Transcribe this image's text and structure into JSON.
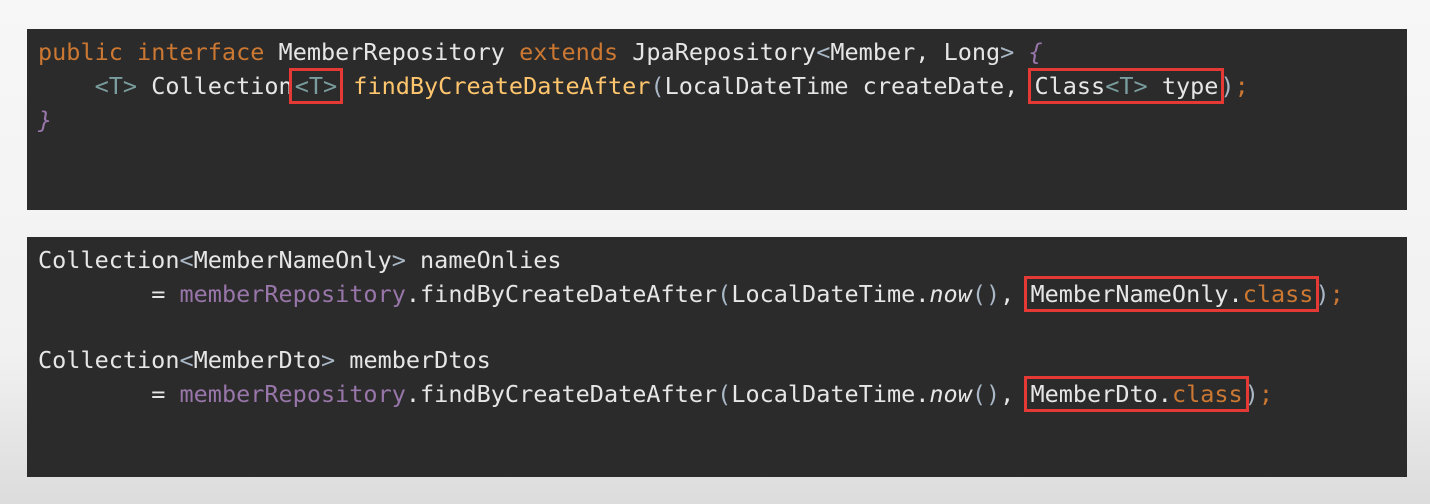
{
  "snippet1": {
    "line1": {
      "public": "public",
      "interface": "interface",
      "name": "MemberRepository",
      "extends": "extends",
      "super": "JpaRepository",
      "lt": "<",
      "arg1": "Member",
      "comma": ", ",
      "arg2": "Long",
      "gt": ">",
      "brace": "{"
    },
    "line2": {
      "indent": "    ",
      "tparam_decl": "<T>",
      "collection": "Collection",
      "return_tparam": "<T>",
      "method": "findByCreateDateAfter",
      "open_paren": "(",
      "param1_type": "LocalDateTime",
      "param1_name": "createDate",
      "comma": ", ",
      "param2_type": "Class",
      "param2_tparam": "<T>",
      "param2_name": "type",
      "close_paren": ")",
      "semicolon": ";"
    },
    "line3": {
      "close_brace": "}"
    }
  },
  "snippet2": {
    "block1": {
      "decl_type": "Collection",
      "decl_lt": "<",
      "decl_arg": "MemberNameOnly",
      "decl_gt": ">",
      "decl_var": "nameOnlies",
      "indent": "        ",
      "equals": "=",
      "receiver": "memberRepository",
      "dot": ".",
      "method": "findByCreateDateAfter",
      "open_paren": "(",
      "arg1_class": "LocalDateTime",
      "arg1_dot": ".",
      "arg1_method": "now",
      "arg1_parens": "()",
      "comma": ", ",
      "arg2_class": "MemberNameOnly",
      "arg2_dot": ".",
      "arg2_kw": "class",
      "close_paren": ")",
      "semicolon": ";"
    },
    "block2": {
      "decl_type": "Collection",
      "decl_lt": "<",
      "decl_arg": "MemberDto",
      "decl_gt": ">",
      "decl_var": "memberDtos",
      "indent": "        ",
      "equals": "=",
      "receiver": "memberRepository",
      "dot": ".",
      "method": "findByCreateDateAfter",
      "open_paren": "(",
      "arg1_class": "LocalDateTime",
      "arg1_dot": ".",
      "arg1_method": "now",
      "arg1_parens": "()",
      "comma": ", ",
      "arg2_class": "MemberDto",
      "arg2_dot": ".",
      "arg2_kw": "class",
      "close_paren": ")",
      "semicolon": ";"
    }
  },
  "colors": {
    "background": "#2b2b2b",
    "keyword": "#cc7832",
    "method": "#ffc66d",
    "field": "#9876aa",
    "highlight_box": "#e53935"
  }
}
